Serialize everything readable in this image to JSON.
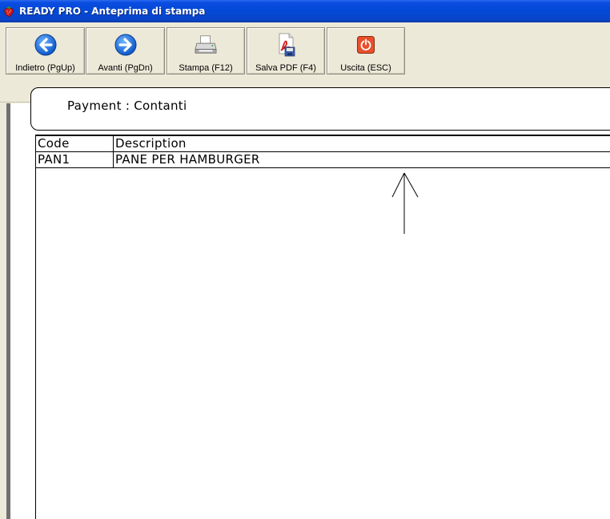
{
  "window": {
    "title": "READY PRO - Anteprima di stampa",
    "app_icon": "strawberry-icon"
  },
  "toolbar": {
    "buttons": [
      {
        "label": "Indietro (PgUp)",
        "icon": "arrow-left-circle-icon",
        "color": "#1e6fd9"
      },
      {
        "label": "Avanti (PgDn)",
        "icon": "arrow-right-circle-icon",
        "color": "#1e6fd9"
      },
      {
        "label": "Stampa (F12)",
        "icon": "printer-icon"
      },
      {
        "label": "Salva PDF (F4)",
        "icon": "pdf-save-icon",
        "color": "#d42020"
      },
      {
        "label": "Uscita (ESC)",
        "icon": "power-exit-icon",
        "color": "#e04a2a"
      }
    ]
  },
  "document": {
    "payment_line": "Payment : Contanti",
    "table": {
      "columns": [
        "Code",
        "Description"
      ],
      "rows": [
        {
          "code": "PAN1",
          "description": "PANE PER HAMBURGER"
        }
      ]
    }
  }
}
